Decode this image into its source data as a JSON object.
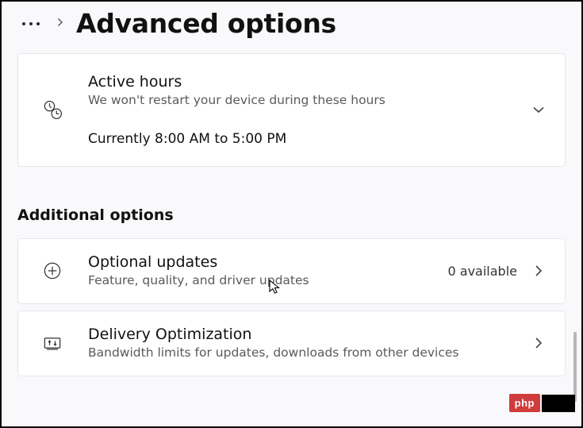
{
  "breadcrumb": {
    "title": "Advanced options"
  },
  "cards": {
    "active_hours": {
      "title": "Active hours",
      "subtitle": "We won't restart your device during these hours",
      "current": "Currently 8:00 AM to 5:00 PM"
    },
    "optional_updates": {
      "title": "Optional updates",
      "subtitle": "Feature, quality, and driver updates",
      "count_label": "0 available"
    },
    "delivery_optimization": {
      "title": "Delivery Optimization",
      "subtitle": "Bandwidth limits for updates, downloads from other devices"
    }
  },
  "section_label": "Additional options",
  "watermark": {
    "php": "php"
  }
}
